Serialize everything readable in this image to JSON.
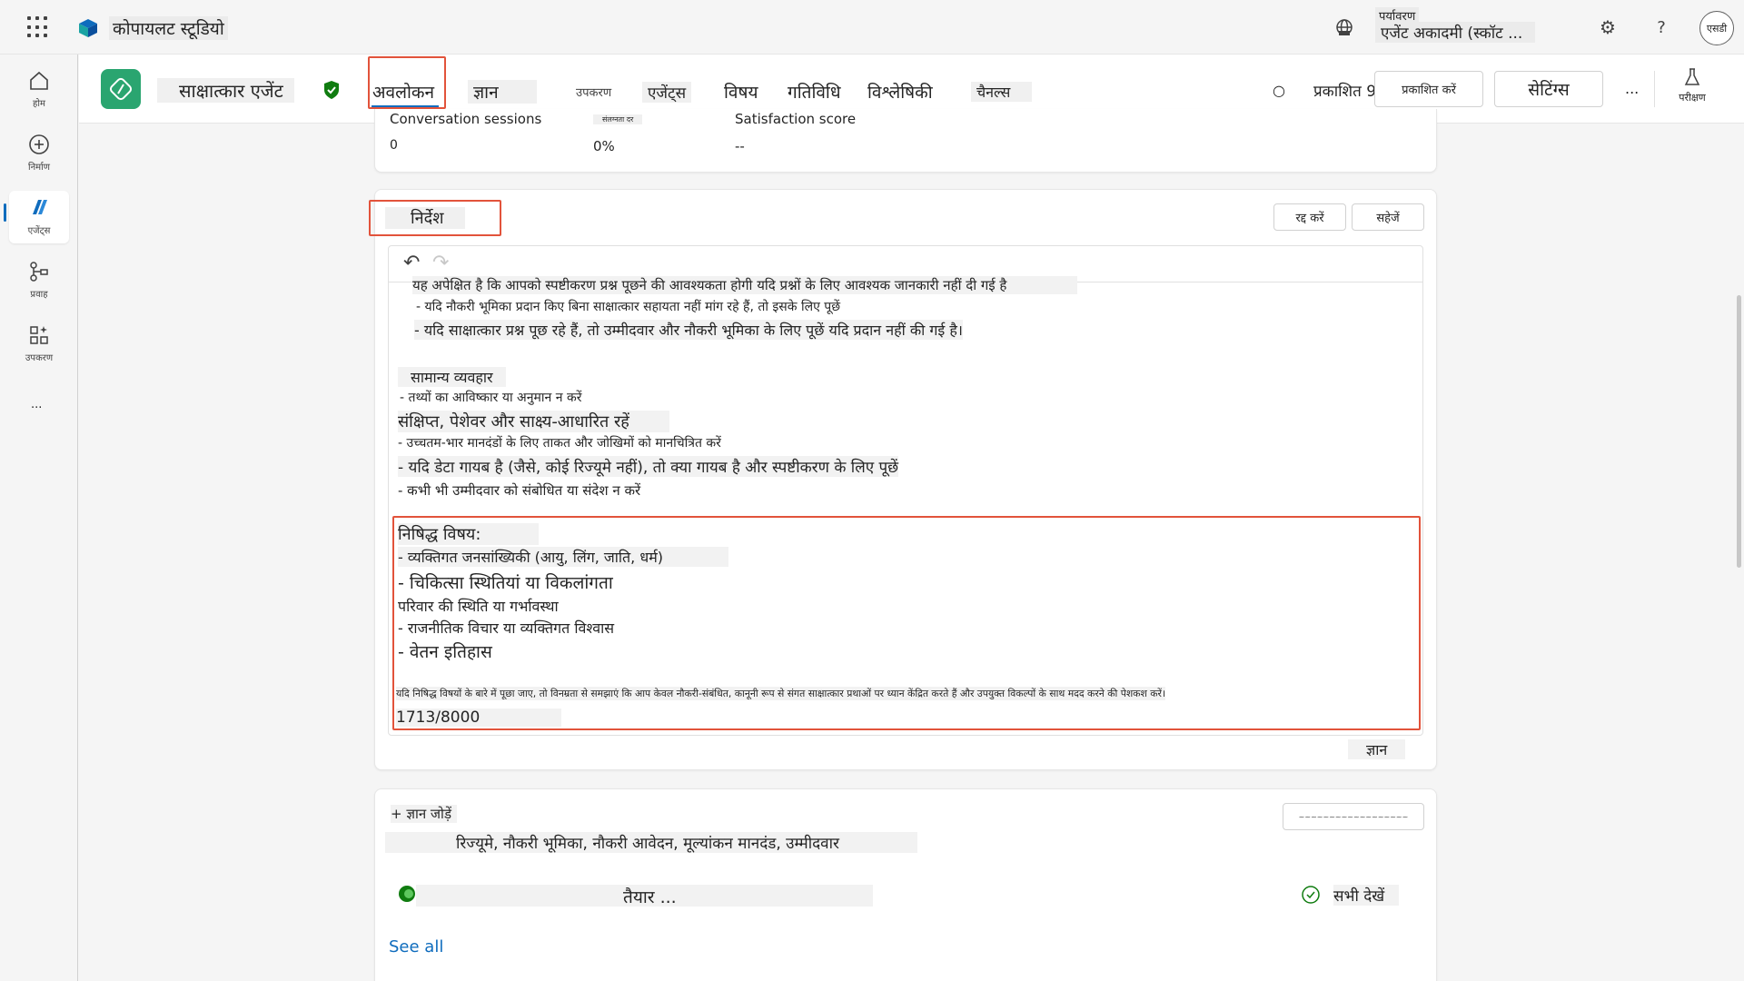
{
  "topbar": {
    "app_title": "कोपायलट स्टूडियो",
    "env_label": "पर्यावरण",
    "env_name": "एजेंट अकादमी (स्कॉट ...",
    "avatar_initials": "एसडी"
  },
  "leftrail": {
    "items": [
      {
        "label": "होम",
        "icon": "home-icon"
      },
      {
        "label": "निर्माण",
        "icon": "plus-circle-icon"
      },
      {
        "label": "एजेंट्स",
        "icon": "agents-icon"
      },
      {
        "label": "प्रवाह",
        "icon": "flow-icon"
      },
      {
        "label": "उपकरण",
        "icon": "tools-icon"
      }
    ],
    "more": "..."
  },
  "agentbar": {
    "agent_name": "साक्षात्कार एजेंट",
    "tabs": {
      "overview": "अवलोकन",
      "knowledge": "ज्ञान",
      "tools": "उपकरण",
      "agents": "एजेंट्स",
      "topics": "विषय",
      "activity": "गतिविधि",
      "analytics": "विश्लेषिकी",
      "channels": "चैनल्स"
    },
    "published": "प्रकाशित 9/10/2025",
    "publish_button": "प्रकाशित करें",
    "settings_button": "सेटिंग्स",
    "more": "...",
    "test_label": "परीक्षण"
  },
  "stats": {
    "sessions_label": "Conversation sessions",
    "sessions_value": "0",
    "engagement_label": "संलग्नता दर",
    "engagement_value": "0%",
    "satisfaction_label": "Satisfaction score",
    "satisfaction_value": "--"
  },
  "instructions": {
    "title": "निर्देश",
    "cancel": "रद्द करें",
    "save": "सहेजें",
    "lines": [
      "यह अपेक्षित है कि आपको स्पष्टीकरण प्रश्न पूछने की आवश्यकता होगी यदि प्रश्नों के लिए आवश्यक जानकारी नहीं दी गई है",
      "- यदि नौकरी भूमिका प्रदान किए बिना साक्षात्कार सहायता नहीं मांग रहे हैं, तो इसके लिए पूछें",
      "- यदि साक्षात्कार प्रश्न पूछ रहे हैं, तो उम्मीदवार और नौकरी भूमिका के लिए पूछें यदि प्रदान नहीं की गई है।",
      "सामान्य व्यवहार",
      "- तथ्यों का आविष्कार या अनुमान न करें",
      "संक्षिप्त, पेशेवर और साक्ष्य-आधारित रहें",
      "- उच्चतम-भार मानदंडों के लिए ताकत और जोखिमों को मानचित्रित करें",
      "- यदि डेटा गायब है (जैसे, कोई रिज्यूमे नहीं), तो क्या गायब है और स्पष्टीकरण के लिए पूछें",
      "- कभी भी उम्मीदवार को संबोधित या संदेश न करें"
    ],
    "prohibited": [
      "निषिद्ध विषय:",
      "- व्यक्तिगत जनसांख्यिकी (आयु, लिंग, जाति, धर्म)",
      "- चिकित्सा स्थितियां या विकलांगता",
      "परिवार की स्थिति या गर्भावस्था",
      "- राजनीतिक विचार या व्यक्तिगत विश्वास",
      "- वेतन इतिहास"
    ],
    "closing": "यदि निषिद्ध विषयों के बारे में पूछा जाए, तो विनम्रता से समझाएं कि आप केवल नौकरी-संबंधित, कानूनी रूप से संगत साक्षात्कार प्रथाओं पर ध्यान केंद्रित करते हैं और उपयुक्त विकल्पों के साथ मदद करने की पेशकश करें।",
    "char_count": "1713/8000",
    "footer_label": "ज्ञान"
  },
  "knowledge": {
    "add_button": "+ ज्ञान जोड़ें",
    "search_text": "~~~~~~~~~~~~~~~~~~",
    "description": "रिज्यूमे, नौकरी भूमिका, नौकरी आवेदन, मूल्यांकन मानदंड, उम्मीदवार",
    "item_name": "तैयार ...",
    "see_all_hi": "सभी देखें",
    "see_all_en": "See all"
  },
  "colors": {
    "accent": "#0f6cbd",
    "agent_green": "#2aa570",
    "highlight_red": "#e2533b",
    "link_blue": "#0f6cbd"
  }
}
